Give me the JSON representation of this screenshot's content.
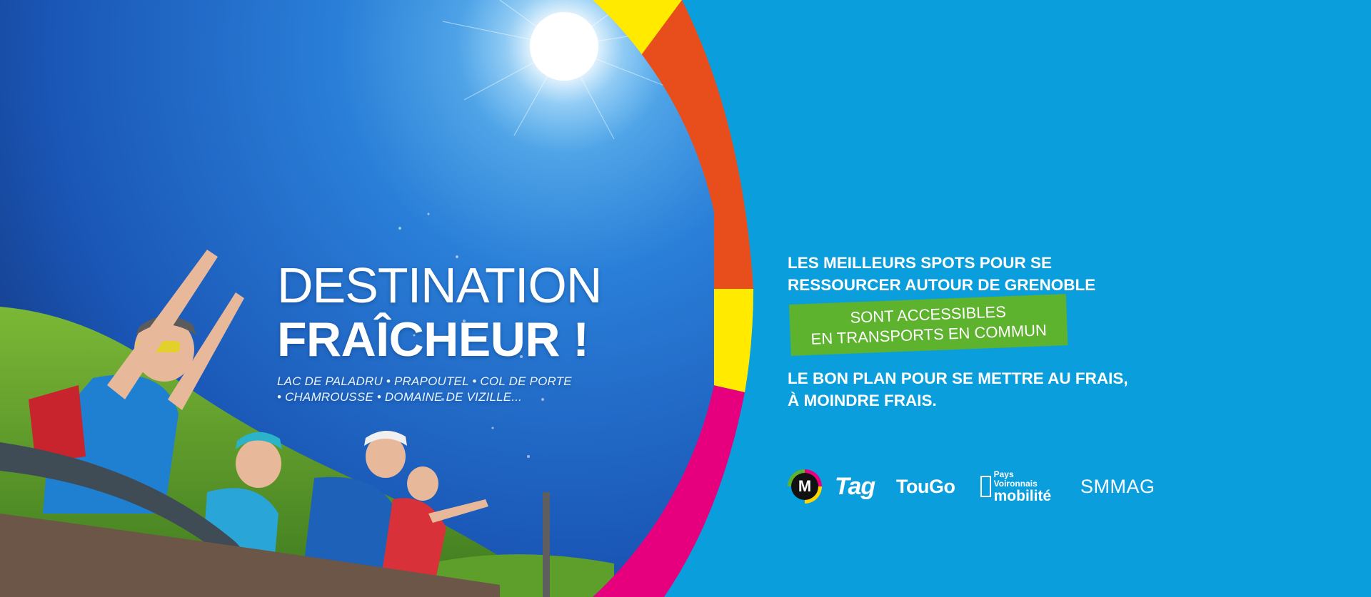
{
  "headline": {
    "line1": "DESTINATION",
    "line2": "FRAÎCHEUR !",
    "places_line1": "LAC DE PALADRU • PRAPOUTEL • COL DE PORTE",
    "places_line2": "• CHAMROUSSE • DOMAINE DE VIZILLE..."
  },
  "message": {
    "intro_line1": "LES MEILLEURS SPOTS POUR SE",
    "intro_line2": "RESSOURCER AUTOUR DE GRENOBLE",
    "highlight_line1": "SONT ACCESSIBLES",
    "highlight_line2": "EN TRANSPORTS EN COMMUN",
    "outro_line1": "LE BON PLAN POUR SE METTRE AU FRAIS,",
    "outro_line2": "À MOINDRE FRAIS."
  },
  "logos": {
    "m": "M",
    "tag": "Tag",
    "tougo": "TouGo",
    "pv_top": "Pays Voironnais",
    "pv_bottom": "mobilité",
    "smmag": "SMMAG"
  },
  "colors": {
    "background": "#0a9fdc",
    "highlight": "#5db22e",
    "ring_yellow": "#ffea00",
    "ring_orange": "#e84e1b",
    "ring_magenta": "#e6007e"
  }
}
